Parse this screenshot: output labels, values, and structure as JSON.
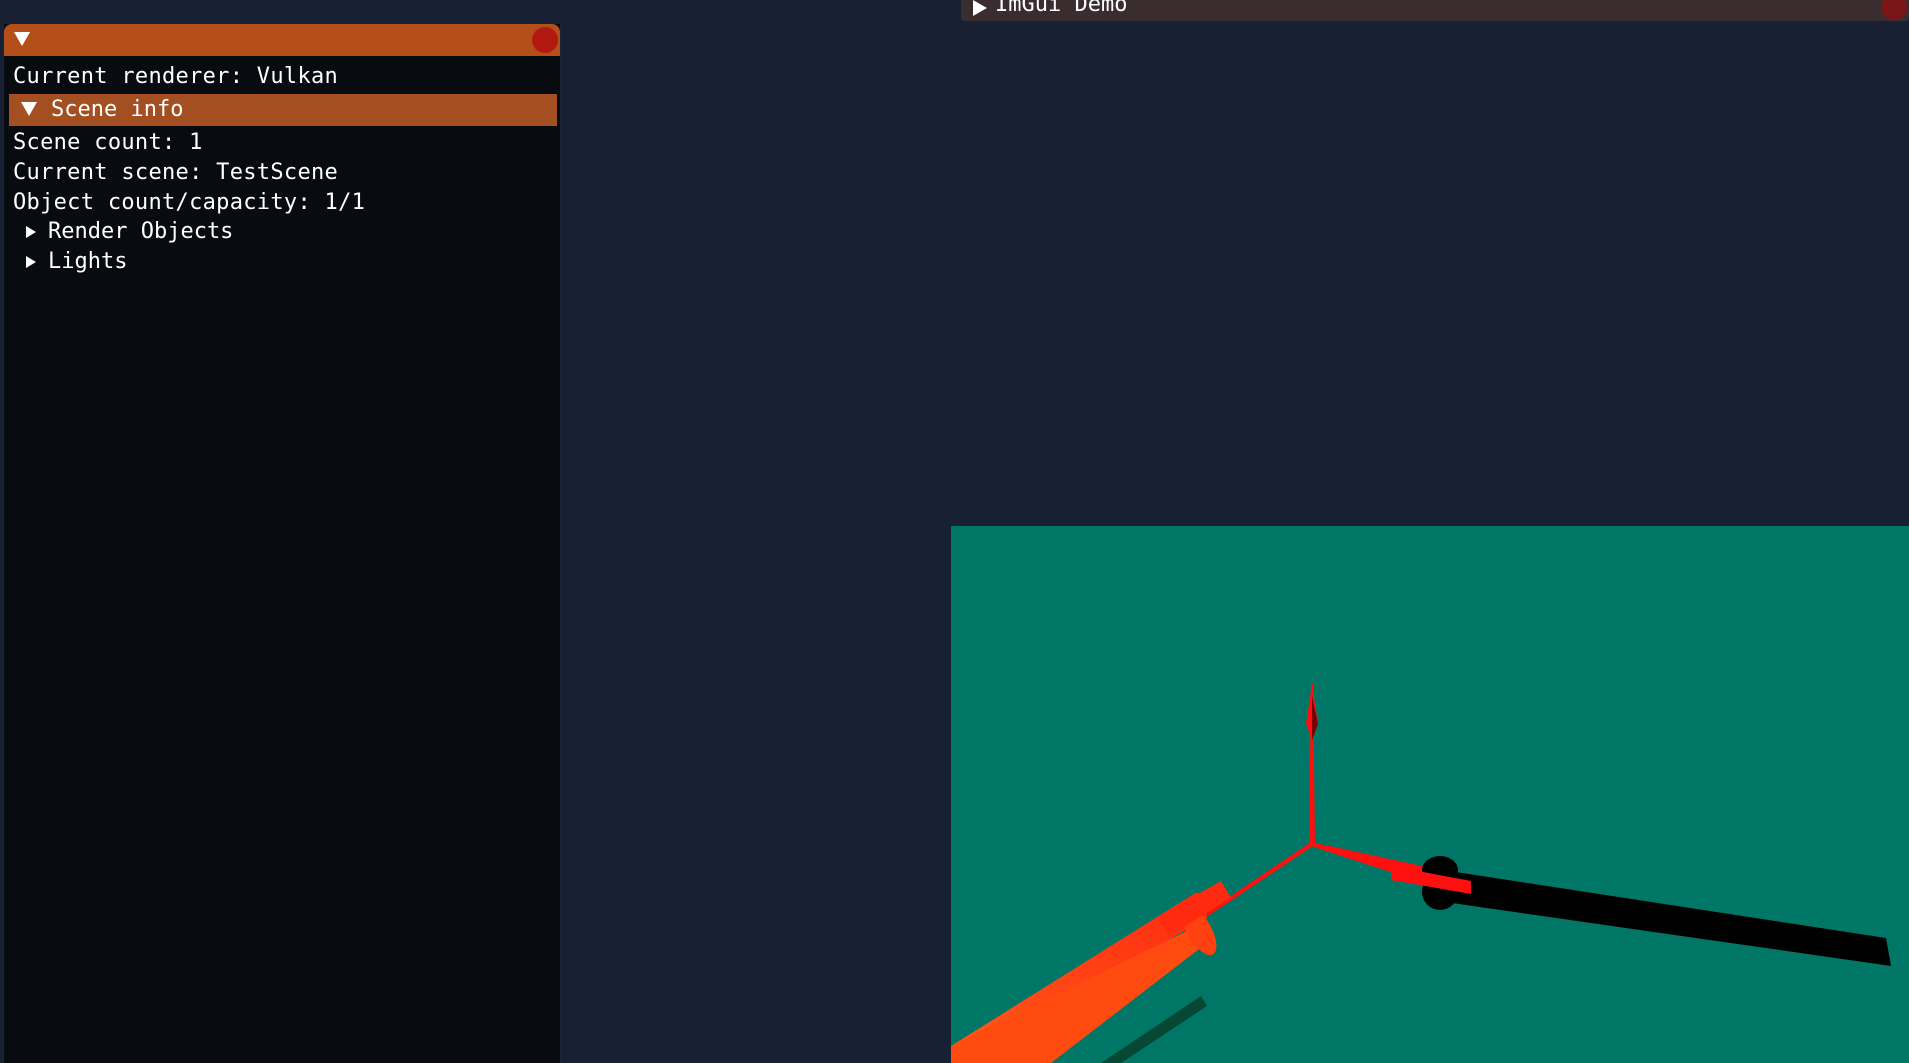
{
  "scene_panel": {
    "renderer_line": "Current renderer: Vulkan",
    "section_header": "Scene info",
    "scene_count_line": "Scene count: 1",
    "current_scene_line": "Current scene: TestScene",
    "object_count_line": "Object count/capacity: 1/1",
    "tree_nodes": [
      {
        "label": "Render Objects"
      },
      {
        "label": "Lights"
      }
    ]
  },
  "demo_window": {
    "title": "ImGui Demo"
  },
  "colors": {
    "background": "#172133",
    "panel_bg": "#080b10",
    "titlebar_accent": "#b54f1a",
    "header_accent": "#a44f21",
    "close_button": "#b11a10",
    "viewport_clear": "#007766",
    "gizmo_red": "#ff1010"
  },
  "icons": {
    "collapse": "triangle-down-icon",
    "expand": "triangle-right-icon",
    "close": "close-circle-icon"
  }
}
